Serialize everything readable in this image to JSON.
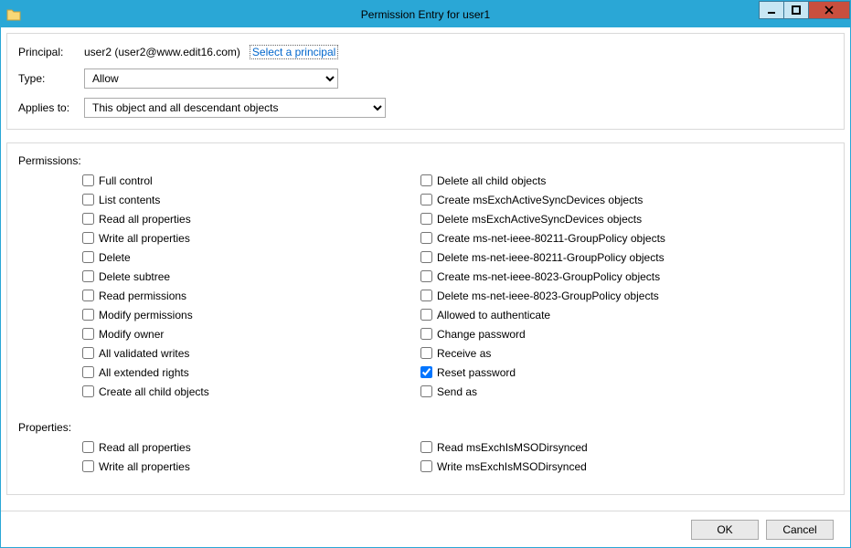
{
  "window": {
    "title": "Permission Entry for user1"
  },
  "header": {
    "principal_label": "Principal:",
    "principal_value": "user2 (user2@www.edit16.com)",
    "select_principal_link": "Select a principal",
    "type_label": "Type:",
    "type_value": "Allow",
    "applies_label": "Applies to:",
    "applies_value": "This object and all descendant objects"
  },
  "permissions_label": "Permissions:",
  "properties_label": "Properties:",
  "permissions": {
    "left": [
      {
        "label": "Full control",
        "checked": false
      },
      {
        "label": "List contents",
        "checked": false
      },
      {
        "label": "Read all properties",
        "checked": false
      },
      {
        "label": "Write all properties",
        "checked": false
      },
      {
        "label": "Delete",
        "checked": false
      },
      {
        "label": "Delete subtree",
        "checked": false
      },
      {
        "label": "Read permissions",
        "checked": false
      },
      {
        "label": "Modify permissions",
        "checked": false
      },
      {
        "label": "Modify owner",
        "checked": false
      },
      {
        "label": "All validated writes",
        "checked": false
      },
      {
        "label": "All extended rights",
        "checked": false
      },
      {
        "label": "Create all child objects",
        "checked": false
      }
    ],
    "right": [
      {
        "label": "Delete all child objects",
        "checked": false
      },
      {
        "label": "Create msExchActiveSyncDevices objects",
        "checked": false
      },
      {
        "label": "Delete msExchActiveSyncDevices objects",
        "checked": false
      },
      {
        "label": "Create ms-net-ieee-80211-GroupPolicy objects",
        "checked": false
      },
      {
        "label": "Delete ms-net-ieee-80211-GroupPolicy objects",
        "checked": false
      },
      {
        "label": "Create ms-net-ieee-8023-GroupPolicy objects",
        "checked": false
      },
      {
        "label": "Delete ms-net-ieee-8023-GroupPolicy objects",
        "checked": false
      },
      {
        "label": "Allowed to authenticate",
        "checked": false
      },
      {
        "label": "Change password",
        "checked": false
      },
      {
        "label": "Receive as",
        "checked": false
      },
      {
        "label": "Reset password",
        "checked": true
      },
      {
        "label": "Send as",
        "checked": false
      }
    ]
  },
  "properties": {
    "left": [
      {
        "label": "Read all properties",
        "checked": false
      },
      {
        "label": "Write all properties",
        "checked": false
      }
    ],
    "right": [
      {
        "label": "Read msExchIsMSODirsynced",
        "checked": false
      },
      {
        "label": "Write msExchIsMSODirsynced",
        "checked": false
      }
    ]
  },
  "footer": {
    "ok_label": "OK",
    "cancel_label": "Cancel"
  }
}
